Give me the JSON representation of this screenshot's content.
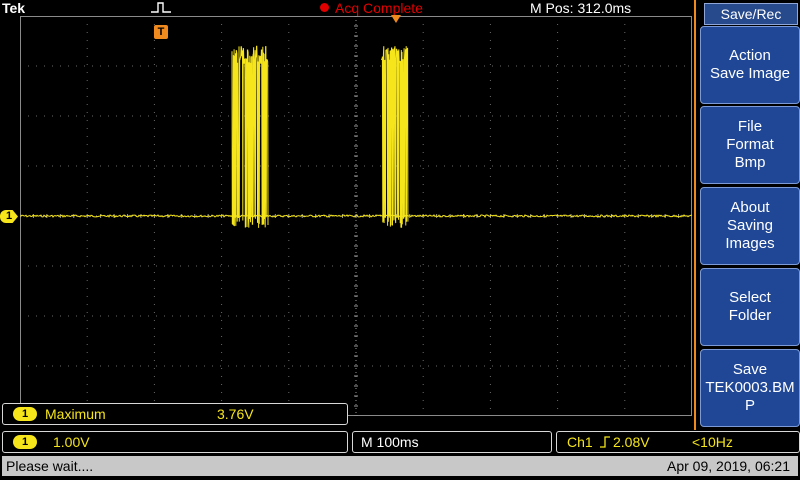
{
  "brand": "Tek",
  "trigger_mode_icon": "single-pulse-icon",
  "acquisition": {
    "status": "Acq Complete",
    "status_color": "#e00000"
  },
  "m_pos": "M Pos: 312.0ms",
  "trigger_marker": "T",
  "channel_marker": "1",
  "trace_color": "#f5e51a",
  "accent_color": "#f08a1e",
  "menu": {
    "title": "Save/Rec",
    "buttons": [
      {
        "label": "Action\nSave Image"
      },
      {
        "label": "File\nFormat\nBmp"
      },
      {
        "label": "About\nSaving\nImages"
      },
      {
        "label": "Select\nFolder"
      },
      {
        "label": "Save\nTEK0003.BM\nP"
      }
    ]
  },
  "measurement": {
    "channel": "1",
    "name": "Maximum",
    "value": "3.76V"
  },
  "vertical": {
    "channel": "1",
    "scale": "1.00V"
  },
  "horizontal": {
    "scale": "M 100ms"
  },
  "trigger": {
    "source": "Ch1",
    "slope_icon": "rising-edge-icon",
    "level": "2.08V",
    "frequency": "<10Hz"
  },
  "status_bar": {
    "message": "Please wait....",
    "datetime": "Apr 09, 2019, 06:21"
  }
}
